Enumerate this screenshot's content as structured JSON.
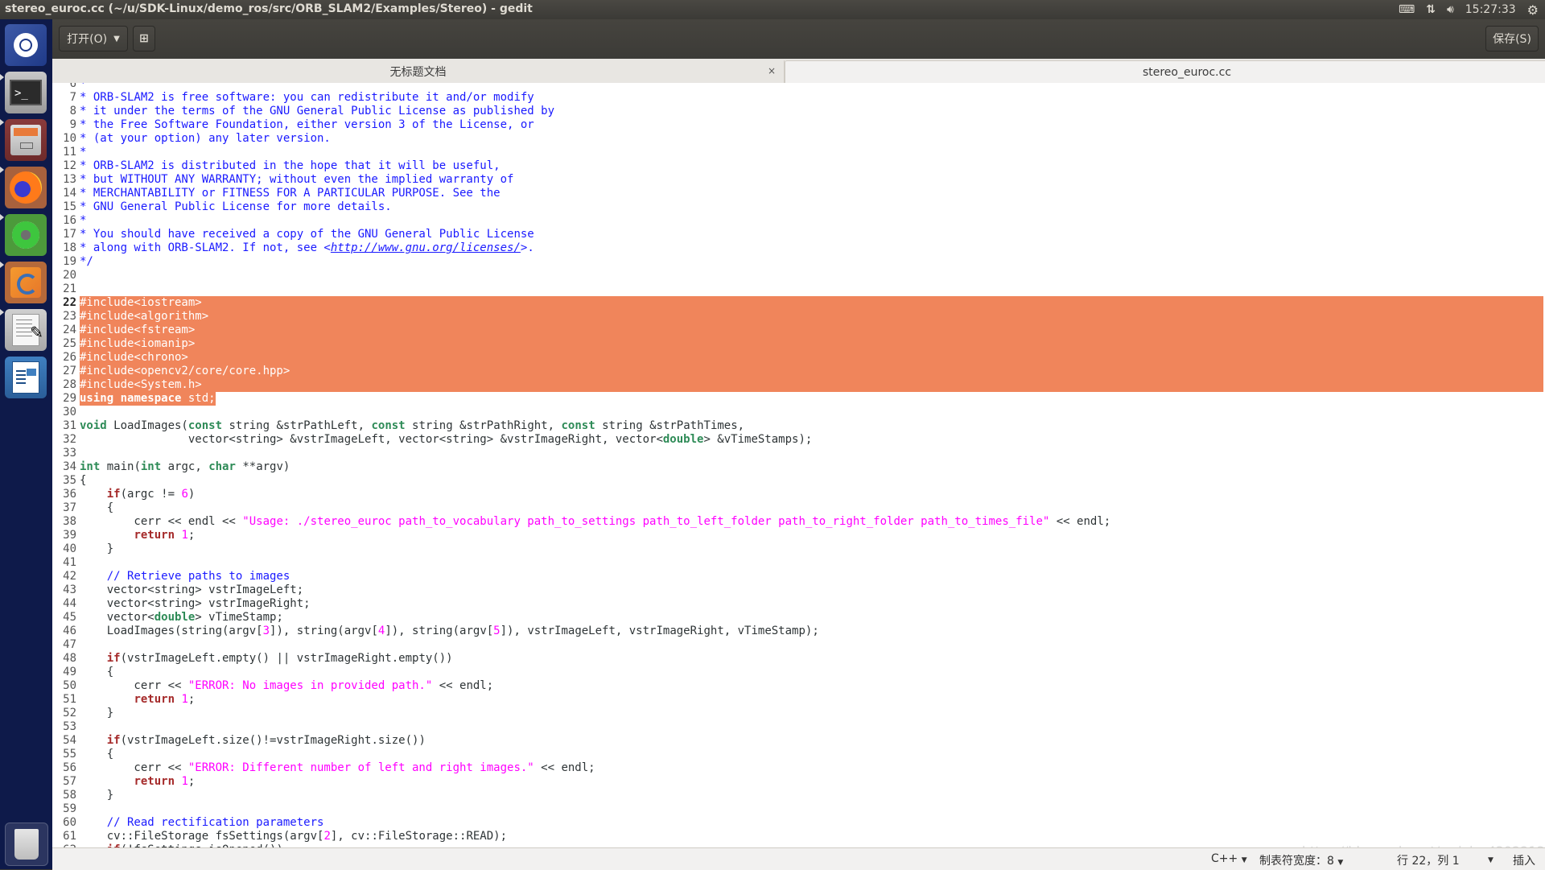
{
  "window": {
    "title": "stereo_euroc.cc (~/u/SDK-Linux/demo_ros/src/ORB_SLAM2/Examples/Stereo) - gedit"
  },
  "tray": {
    "keyboard_icon": "keyboard-icon",
    "network_icon": "network-updown-icon",
    "volume_icon": "volume-icon",
    "clock": "15:27:33",
    "power_icon": "gear-power-icon"
  },
  "launcher": {
    "items": [
      {
        "name": "ubuntu-dash",
        "icon": "ubuntu-logo-icon"
      },
      {
        "name": "terminal",
        "icon": "terminal-icon"
      },
      {
        "name": "files",
        "icon": "file-cabinet-icon"
      },
      {
        "name": "firefox",
        "icon": "firefox-icon"
      },
      {
        "name": "kdevelop",
        "icon": "kde-gear-icon"
      },
      {
        "name": "meld",
        "icon": "swirl-icon"
      },
      {
        "name": "gedit",
        "icon": "text-editor-icon"
      },
      {
        "name": "libreoffice-writer",
        "icon": "writer-document-icon"
      },
      {
        "name": "trash",
        "icon": "trash-icon"
      }
    ]
  },
  "toolbar": {
    "open_label": "打开(O)",
    "new_tab_icon": "new-document-icon",
    "save_label": "保存(S)"
  },
  "tabs": [
    {
      "label": "无标题文档",
      "close": "×",
      "active": false
    },
    {
      "label": "stereo_euroc.cc",
      "close": "×",
      "active": true
    }
  ],
  "editor": {
    "current_line": 22,
    "lines": [
      {
        "n": 6,
        "html": "<span class='c-com'>*</span>"
      },
      {
        "n": 7,
        "html": "<span class='c-com'>* ORB-SLAM2 is free software: you can redistribute it and/or modify</span>"
      },
      {
        "n": 8,
        "html": "<span class='c-com'>* it under the terms of the GNU General Public License as published by</span>"
      },
      {
        "n": 9,
        "html": "<span class='c-com'>* the Free Software Foundation, either version 3 of the License, or</span>"
      },
      {
        "n": 10,
        "html": "<span class='c-com'>* (at your option) any later version.</span>"
      },
      {
        "n": 11,
        "html": "<span class='c-com'>*</span>"
      },
      {
        "n": 12,
        "html": "<span class='c-com'>* ORB-SLAM2 is distributed in the hope that it will be useful,</span>"
      },
      {
        "n": 13,
        "html": "<span class='c-com'>* but WITHOUT ANY WARRANTY; without even the implied warranty of</span>"
      },
      {
        "n": 14,
        "html": "<span class='c-com'>* MERCHANTABILITY or FITNESS FOR A PARTICULAR PURPOSE. See the</span>"
      },
      {
        "n": 15,
        "html": "<span class='c-com'>* GNU General Public License for more details.</span>"
      },
      {
        "n": 16,
        "html": "<span class='c-com'>*</span>"
      },
      {
        "n": 17,
        "html": "<span class='c-com'>* You should have received a copy of the GNU General Public License</span>"
      },
      {
        "n": 18,
        "html": "<span class='c-com'>* along with ORB-SLAM2. If not, see &lt;<span class='c-link'>http://www.gnu.org/licenses/</span>&gt;.</span>"
      },
      {
        "n": 19,
        "html": "<span class='c-com'>*/</span>"
      },
      {
        "n": 20,
        "html": ""
      },
      {
        "n": 21,
        "html": ""
      },
      {
        "n": 22,
        "html": "#include&lt;iostream&gt;",
        "sel": "full"
      },
      {
        "n": 23,
        "html": "#include&lt;algorithm&gt;",
        "sel": "full"
      },
      {
        "n": 24,
        "html": "#include&lt;fstream&gt;",
        "sel": "full"
      },
      {
        "n": 25,
        "html": "#include&lt;iomanip&gt;",
        "sel": "full"
      },
      {
        "n": 26,
        "html": "#include&lt;chrono&gt;",
        "sel": "full"
      },
      {
        "n": 27,
        "html": "#include&lt;opencv2/core/core.hpp&gt;",
        "sel": "full"
      },
      {
        "n": 28,
        "html": "#include&lt;System.h&gt;",
        "sel": "full"
      },
      {
        "n": 29,
        "html": "<span class='c-kw'>using</span> <span class='c-kw'>namespace</span> std;",
        "sel": "part"
      },
      {
        "n": 30,
        "html": ""
      },
      {
        "n": 31,
        "html": "<span class='c-kw'>void</span> LoadImages(<span class='c-kw'>const</span> string &amp;strPathLeft, <span class='c-kw'>const</span> string &amp;strPathRight, <span class='c-kw'>const</span> string &amp;strPathTimes,"
      },
      {
        "n": 32,
        "html": "                vector&lt;string&gt; &amp;vstrImageLeft, vector&lt;string&gt; &amp;vstrImageRight, vector&lt;<span class='c-kw'>double</span>&gt; &amp;vTimeStamps);"
      },
      {
        "n": 33,
        "html": ""
      },
      {
        "n": 34,
        "html": "<span class='c-kw'>int</span> main(<span class='c-kw'>int</span> argc, <span class='c-kw'>char</span> **argv)"
      },
      {
        "n": 35,
        "html": "{"
      },
      {
        "n": 36,
        "html": "    <span class='c-ctl'>if</span>(argc != <span class='c-str'>6</span>)"
      },
      {
        "n": 37,
        "html": "    {"
      },
      {
        "n": 38,
        "html": "        cerr &lt;&lt; endl &lt;&lt; <span class='c-str'>\"Usage: ./stereo_euroc path_to_vocabulary path_to_settings path_to_left_folder path_to_right_folder path_to_times_file\"</span> &lt;&lt; endl;"
      },
      {
        "n": 39,
        "html": "        <span class='c-ctl'>return</span> <span class='c-str'>1</span>;"
      },
      {
        "n": 40,
        "html": "    }"
      },
      {
        "n": 41,
        "html": ""
      },
      {
        "n": 42,
        "html": "    <span class='c-com'>// Retrieve paths to images</span>"
      },
      {
        "n": 43,
        "html": "    vector&lt;string&gt; vstrImageLeft;"
      },
      {
        "n": 44,
        "html": "    vector&lt;string&gt; vstrImageRight;"
      },
      {
        "n": 45,
        "html": "    vector&lt;<span class='c-kw'>double</span>&gt; vTimeStamp;"
      },
      {
        "n": 46,
        "html": "    LoadImages(string(argv[<span class='c-str'>3</span>]), string(argv[<span class='c-str'>4</span>]), string(argv[<span class='c-str'>5</span>]), vstrImageLeft, vstrImageRight, vTimeStamp);"
      },
      {
        "n": 47,
        "html": ""
      },
      {
        "n": 48,
        "html": "    <span class='c-ctl'>if</span>(vstrImageLeft.empty() || vstrImageRight.empty())"
      },
      {
        "n": 49,
        "html": "    {"
      },
      {
        "n": 50,
        "html": "        cerr &lt;&lt; <span class='c-str'>\"ERROR: No images in provided path.\"</span> &lt;&lt; endl;"
      },
      {
        "n": 51,
        "html": "        <span class='c-ctl'>return</span> <span class='c-str'>1</span>;"
      },
      {
        "n": 52,
        "html": "    }"
      },
      {
        "n": 53,
        "html": ""
      },
      {
        "n": 54,
        "html": "    <span class='c-ctl'>if</span>(vstrImageLeft.size()!=vstrImageRight.size())"
      },
      {
        "n": 55,
        "html": "    {"
      },
      {
        "n": 56,
        "html": "        cerr &lt;&lt; <span class='c-str'>\"ERROR: Different number of left and right images.\"</span> &lt;&lt; endl;"
      },
      {
        "n": 57,
        "html": "        <span class='c-ctl'>return</span> <span class='c-str'>1</span>;"
      },
      {
        "n": 58,
        "html": "    }"
      },
      {
        "n": 59,
        "html": ""
      },
      {
        "n": 60,
        "html": "    <span class='c-com'>// Read rectification parameters</span>"
      },
      {
        "n": 61,
        "html": "    cv::FileStorage fsSettings(argv[<span class='c-str'>2</span>], cv::FileStorage::READ);"
      },
      {
        "n": 62,
        "html": "    <span class='c-ctl'>if</span>(!fsSettings.isOpened())"
      }
    ]
  },
  "statusbar": {
    "language": "C++",
    "tab_width_label": "制表符宽度：",
    "tab_width_value": "8",
    "cursor_position": "行 22，列 1",
    "insert_mode": "插入"
  },
  "watermark": "https://blog.csdn.net/weixin_43922139",
  "colors": {
    "selection": "#f0855b",
    "comment": "#1a1aff",
    "keyword": "#2e8b57",
    "control": "#a52a2a",
    "string_number": "#ff00ff",
    "launcher_bg": "#0e1a4a"
  }
}
